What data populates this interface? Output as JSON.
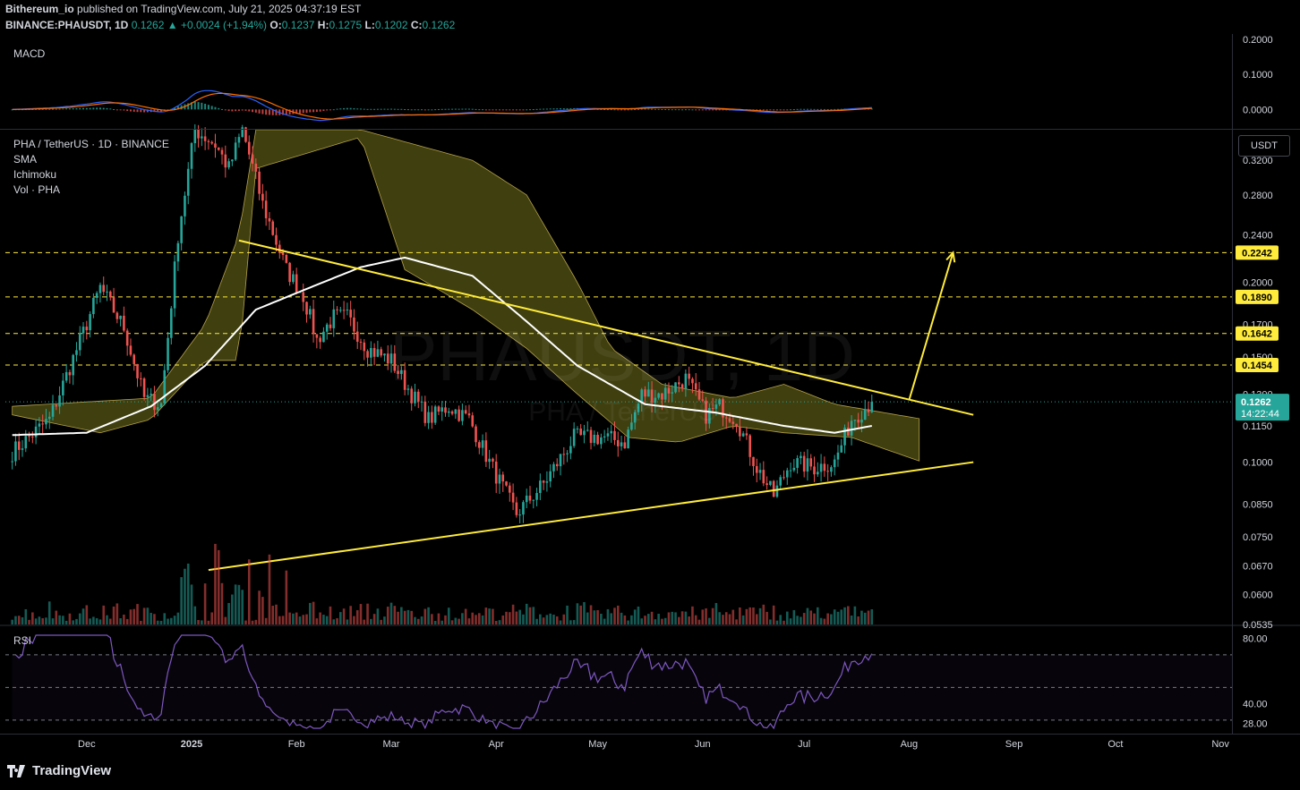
{
  "header": {
    "publisher": "Bithereum_io",
    "published_text": "published on TradingView.com, July 21, 2025 04:37:19 EST",
    "symbol_line": "BINANCE:PHAUSDT, 1D",
    "last": "0.1262",
    "change": "+0.0024 (+1.94%)",
    "o_label": "O:",
    "o": "0.1237",
    "h_label": "H:",
    "h": "0.1275",
    "l_label": "L:",
    "l": "0.1202",
    "c_label": "C:",
    "c": "0.1262"
  },
  "panes": {
    "macd_label": "MACD",
    "main_title": "PHA / TetherUS · 1D · BINANCE",
    "indicators": [
      "SMA",
      "Ichimoku",
      "Vol · PHA"
    ],
    "rsi_label": "RSI"
  },
  "currency_button": "USDT",
  "watermark": {
    "symbol": "PHAUSDT, 1D",
    "pair": "PHA / TetherUS"
  },
  "branding": {
    "name": "TradingView",
    "icon": "tradingview-logo-icon"
  },
  "colors": {
    "background": "#000000",
    "up": "#26a69a",
    "down": "#ef5350",
    "trendline": "#ffeb3b",
    "sma": "#ffffff",
    "cloud": "#4a4a12",
    "rsi": "#7e57c2",
    "macd": "#2962ff",
    "signal": "#ff6d00",
    "level_tag": "#ffeb3b",
    "price_tag": "#26a69a"
  },
  "chart_data": {
    "type": "candlestick",
    "scale": "log",
    "x_axis": {
      "labels": [
        "Dec",
        "2025",
        "Feb",
        "Mar",
        "Apr",
        "May",
        "Jun",
        "Jul",
        "Aug",
        "Sep",
        "Oct",
        "Nov"
      ]
    },
    "price_axis": {
      "ticks": [
        "0.3200",
        "0.2800",
        "0.2400",
        "0.2000",
        "0.1700",
        "0.1500",
        "0.1300",
        "0.1150",
        "0.1000",
        "0.0850",
        "0.0750",
        "0.0670",
        "0.0600",
        "0.0535"
      ],
      "range": [
        0.0535,
        0.36
      ]
    },
    "horizontal_levels": [
      {
        "label": "0.2242",
        "value": 0.2242
      },
      {
        "label": "0.1890",
        "value": 0.189
      },
      {
        "label": "0.1642",
        "value": 0.1642
      },
      {
        "label": "0.1454",
        "value": 0.1454
      }
    ],
    "last_price": {
      "label": "0.1262",
      "value": 0.1262,
      "countdown": "14:22:44"
    },
    "macd_axis": {
      "ticks": [
        "0.2000",
        "0.1000",
        "0.0000"
      ],
      "range": [
        -0.04,
        0.2
      ]
    },
    "rsi_axis": {
      "ticks": [
        "80.00",
        "40.00",
        "28.00"
      ],
      "range": [
        25,
        82
      ]
    },
    "anchors": [
      {
        "x": "Nov 9",
        "close": 0.104
      },
      {
        "x": "Nov 20",
        "close": 0.118
      },
      {
        "x": "Nov 30",
        "close": 0.165
      },
      {
        "x": "Dec 5",
        "close": 0.196
      },
      {
        "x": "Dec 12",
        "close": 0.168
      },
      {
        "x": "Dec 18",
        "close": 0.128
      },
      {
        "x": "Dec 23",
        "close": 0.125
      },
      {
        "x": "Dec 28",
        "close": 0.24
      },
      {
        "x": "Jan 2",
        "close": 0.36
      },
      {
        "x": "Jan 8",
        "close": 0.34
      },
      {
        "x": "Jan 12",
        "close": 0.31
      },
      {
        "x": "Jan 16",
        "close": 0.36
      },
      {
        "x": "Jan 22",
        "close": 0.27
      },
      {
        "x": "Jan 29",
        "close": 0.21
      },
      {
        "x": "Feb 3",
        "close": 0.19
      },
      {
        "x": "Feb 7",
        "close": 0.16
      },
      {
        "x": "Feb 12",
        "close": 0.175
      },
      {
        "x": "Feb 16",
        "close": 0.175
      },
      {
        "x": "Feb 22",
        "close": 0.155
      },
      {
        "x": "Mar 1",
        "close": 0.148
      },
      {
        "x": "Mar 7",
        "close": 0.13
      },
      {
        "x": "Mar 12",
        "close": 0.118
      },
      {
        "x": "Mar 18",
        "close": 0.124
      },
      {
        "x": "Mar 24",
        "close": 0.118
      },
      {
        "x": "Mar 30",
        "close": 0.1
      },
      {
        "x": "Apr 7",
        "close": 0.082
      },
      {
        "x": "Apr 15",
        "close": 0.092
      },
      {
        "x": "Apr 24",
        "close": 0.11
      },
      {
        "x": "May 3",
        "close": 0.11
      },
      {
        "x": "May 9",
        "close": 0.108
      },
      {
        "x": "May 14",
        "close": 0.13
      },
      {
        "x": "May 20",
        "close": 0.13
      },
      {
        "x": "May 27",
        "close": 0.138
      },
      {
        "x": "Jun 2",
        "close": 0.12
      },
      {
        "x": "Jun 6",
        "close": 0.124
      },
      {
        "x": "Jun 11",
        "close": 0.118
      },
      {
        "x": "Jun 17",
        "close": 0.098
      },
      {
        "x": "Jun 22",
        "close": 0.088
      },
      {
        "x": "Jun 27",
        "close": 0.1
      },
      {
        "x": "Jul 4",
        "close": 0.098
      },
      {
        "x": "Jul 10",
        "close": 0.1
      },
      {
        "x": "Jul 15",
        "close": 0.118
      },
      {
        "x": "Jul 21",
        "close": 0.1262
      }
    ],
    "sma_anchors": [
      {
        "x": "Nov 9",
        "value": 0.111
      },
      {
        "x": "Dec 1",
        "value": 0.112
      },
      {
        "x": "Dec 20",
        "value": 0.124
      },
      {
        "x": "Jan 5",
        "value": 0.145
      },
      {
        "x": "Jan 20",
        "value": 0.18
      },
      {
        "x": "Feb 5",
        "value": 0.196
      },
      {
        "x": "Feb 20",
        "value": 0.212
      },
      {
        "x": "Mar 5",
        "value": 0.22
      },
      {
        "x": "Mar 25",
        "value": 0.205
      },
      {
        "x": "Apr 10",
        "value": 0.172
      },
      {
        "x": "Apr 25",
        "value": 0.145
      },
      {
        "x": "May 15",
        "value": 0.125
      },
      {
        "x": "Jun 5",
        "value": 0.121
      },
      {
        "x": "Jun 25",
        "value": 0.115
      },
      {
        "x": "Jul 10",
        "value": 0.112
      },
      {
        "x": "Jul 21",
        "value": 0.115
      }
    ],
    "cloud_top_anchors": [
      {
        "x": "Nov 9",
        "value": 0.124
      },
      {
        "x": "Dec 20",
        "value": 0.128
      },
      {
        "x": "Jan 5",
        "value": 0.17
      },
      {
        "x": "Jan 15",
        "value": 0.24
      },
      {
        "x": "Jan 20",
        "value": 0.36
      },
      {
        "x": "Feb 20",
        "value": 0.36
      },
      {
        "x": "Mar 25",
        "value": 0.32
      },
      {
        "x": "Apr 10",
        "value": 0.28
      },
      {
        "x": "Apr 25",
        "value": 0.2
      },
      {
        "x": "May 5",
        "value": 0.155
      },
      {
        "x": "May 20",
        "value": 0.135
      },
      {
        "x": "Jun 10",
        "value": 0.128
      },
      {
        "x": "Jun 25",
        "value": 0.135
      },
      {
        "x": "Jul 10",
        "value": 0.125
      },
      {
        "x": "Aug 5",
        "value": 0.118
      }
    ],
    "cloud_bottom_anchors": [
      {
        "x": "Nov 9",
        "value": 0.12
      },
      {
        "x": "Dec 5",
        "value": 0.112
      },
      {
        "x": "Dec 20",
        "value": 0.118
      },
      {
        "x": "Jan 5",
        "value": 0.148
      },
      {
        "x": "Jan 15",
        "value": 0.148
      },
      {
        "x": "Jan 20",
        "value": 0.31
      },
      {
        "x": "Feb 20",
        "value": 0.35
      },
      {
        "x": "Mar 5",
        "value": 0.21
      },
      {
        "x": "Mar 25",
        "value": 0.18
      },
      {
        "x": "Apr 10",
        "value": 0.155
      },
      {
        "x": "Apr 25",
        "value": 0.13
      },
      {
        "x": "May 10",
        "value": 0.11
      },
      {
        "x": "May 25",
        "value": 0.108
      },
      {
        "x": "Jun 10",
        "value": 0.115
      },
      {
        "x": "Jun 25",
        "value": 0.112
      },
      {
        "x": "Jul 15",
        "value": 0.11
      },
      {
        "x": "Aug 5",
        "value": 0.1
      }
    ],
    "trendlines": [
      {
        "name": "descending resistance",
        "from": {
          "x": "Jan 15",
          "y": 0.235
        },
        "to": {
          "x": "Aug 20",
          "y": 0.12
        }
      },
      {
        "name": "ascending support",
        "from": {
          "x": "Jan 6",
          "y": 0.066
        },
        "to": {
          "x": "Aug 20",
          "y": 0.1
        }
      },
      {
        "name": "breakout projection arrow",
        "from": {
          "x": "Aug 1",
          "y": 0.127
        },
        "to": {
          "x": "Aug 14",
          "y": 0.2242
        }
      }
    ]
  }
}
